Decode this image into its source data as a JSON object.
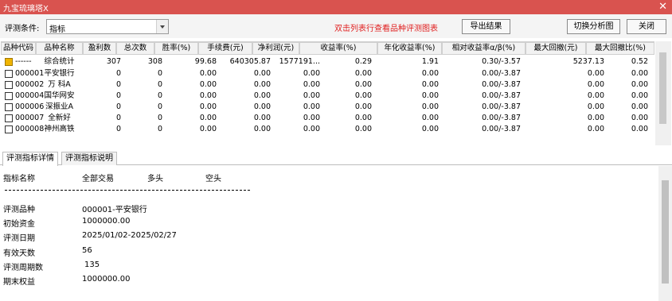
{
  "window": {
    "title": "九宝琉璃塔X",
    "close_glyph": "✕"
  },
  "toolbar": {
    "condition_label": "评测条件:",
    "condition_value": "指标",
    "hint": "双击列表行查看品种评测图表",
    "export_label": "导出结果",
    "switch_label": "切换分析图",
    "close_label": "关闭"
  },
  "table": {
    "columns": [
      "品种代码",
      "品种名称",
      "盈利数",
      "总次数",
      "胜率(%)",
      "手续费(元)",
      "净利润(元)",
      "收益率(%)",
      "年化收益率(%)",
      "相对收益率α/β(%)",
      "最大回撤(元)",
      "最大回撤比(%)"
    ],
    "rows": [
      {
        "code": "------",
        "name": "综合统计",
        "wins": "307",
        "total": "308",
        "winrate": "99.68",
        "fee": "640305.87",
        "profit": "1577191...",
        "ret": "0.29",
        "annual": "1.91",
        "rel": "0.30/-3.57",
        "maxdd": "5237.13",
        "maxddr": "0.52",
        "icon": "yellow"
      },
      {
        "code": "000001",
        "name": "平安银行",
        "wins": "0",
        "total": "0",
        "winrate": "0.00",
        "fee": "0.00",
        "profit": "0.00",
        "ret": "0.00",
        "annual": "0.00",
        "rel": "0.00/-3.87",
        "maxdd": "0.00",
        "maxddr": "0.00",
        "icon": "box"
      },
      {
        "code": "000002",
        "name": "万 科A",
        "wins": "0",
        "total": "0",
        "winrate": "0.00",
        "fee": "0.00",
        "profit": "0.00",
        "ret": "0.00",
        "annual": "0.00",
        "rel": "0.00/-3.87",
        "maxdd": "0.00",
        "maxddr": "0.00",
        "icon": "box"
      },
      {
        "code": "000004",
        "name": "国华网安",
        "wins": "0",
        "total": "0",
        "winrate": "0.00",
        "fee": "0.00",
        "profit": "0.00",
        "ret": "0.00",
        "annual": "0.00",
        "rel": "0.00/-3.87",
        "maxdd": "0.00",
        "maxddr": "0.00",
        "icon": "box"
      },
      {
        "code": "000006",
        "name": "深振业A",
        "wins": "0",
        "total": "0",
        "winrate": "0.00",
        "fee": "0.00",
        "profit": "0.00",
        "ret": "0.00",
        "annual": "0.00",
        "rel": "0.00/-3.87",
        "maxdd": "0.00",
        "maxddr": "0.00",
        "icon": "box"
      },
      {
        "code": "000007",
        "name": "全新好",
        "wins": "0",
        "total": "0",
        "winrate": "0.00",
        "fee": "0.00",
        "profit": "0.00",
        "ret": "0.00",
        "annual": "0.00",
        "rel": "0.00/-3.87",
        "maxdd": "0.00",
        "maxddr": "0.00",
        "icon": "box"
      },
      {
        "code": "000008",
        "name": "神州高铁",
        "wins": "0",
        "total": "0",
        "winrate": "0.00",
        "fee": "0.00",
        "profit": "0.00",
        "ret": "0.00",
        "annual": "0.00",
        "rel": "0.00/-3.87",
        "maxdd": "0.00",
        "maxddr": "0.00",
        "icon": "box"
      }
    ]
  },
  "tabs": [
    "评测指标详情",
    "评测指标说明"
  ],
  "detail": {
    "headers": [
      "指标名称",
      "全部交易",
      "多头",
      "空头"
    ],
    "items": [
      {
        "label": "评测品种",
        "value": "000001-平安银行"
      },
      {
        "label": "初始资金",
        "value": "1000000.00"
      },
      {
        "label": "评测日期",
        "value": "2025/01/02-2025/02/27"
      },
      {
        "label": "有效天数",
        "value": "56"
      },
      {
        "label": "评测周期数",
        "value": "135"
      },
      {
        "label": "期末权益",
        "value": "1000000.00"
      }
    ]
  },
  "colors": {
    "title_bar": "#d9534f",
    "hint_text": "#e02020",
    "summary_icon": "#f0b400"
  }
}
